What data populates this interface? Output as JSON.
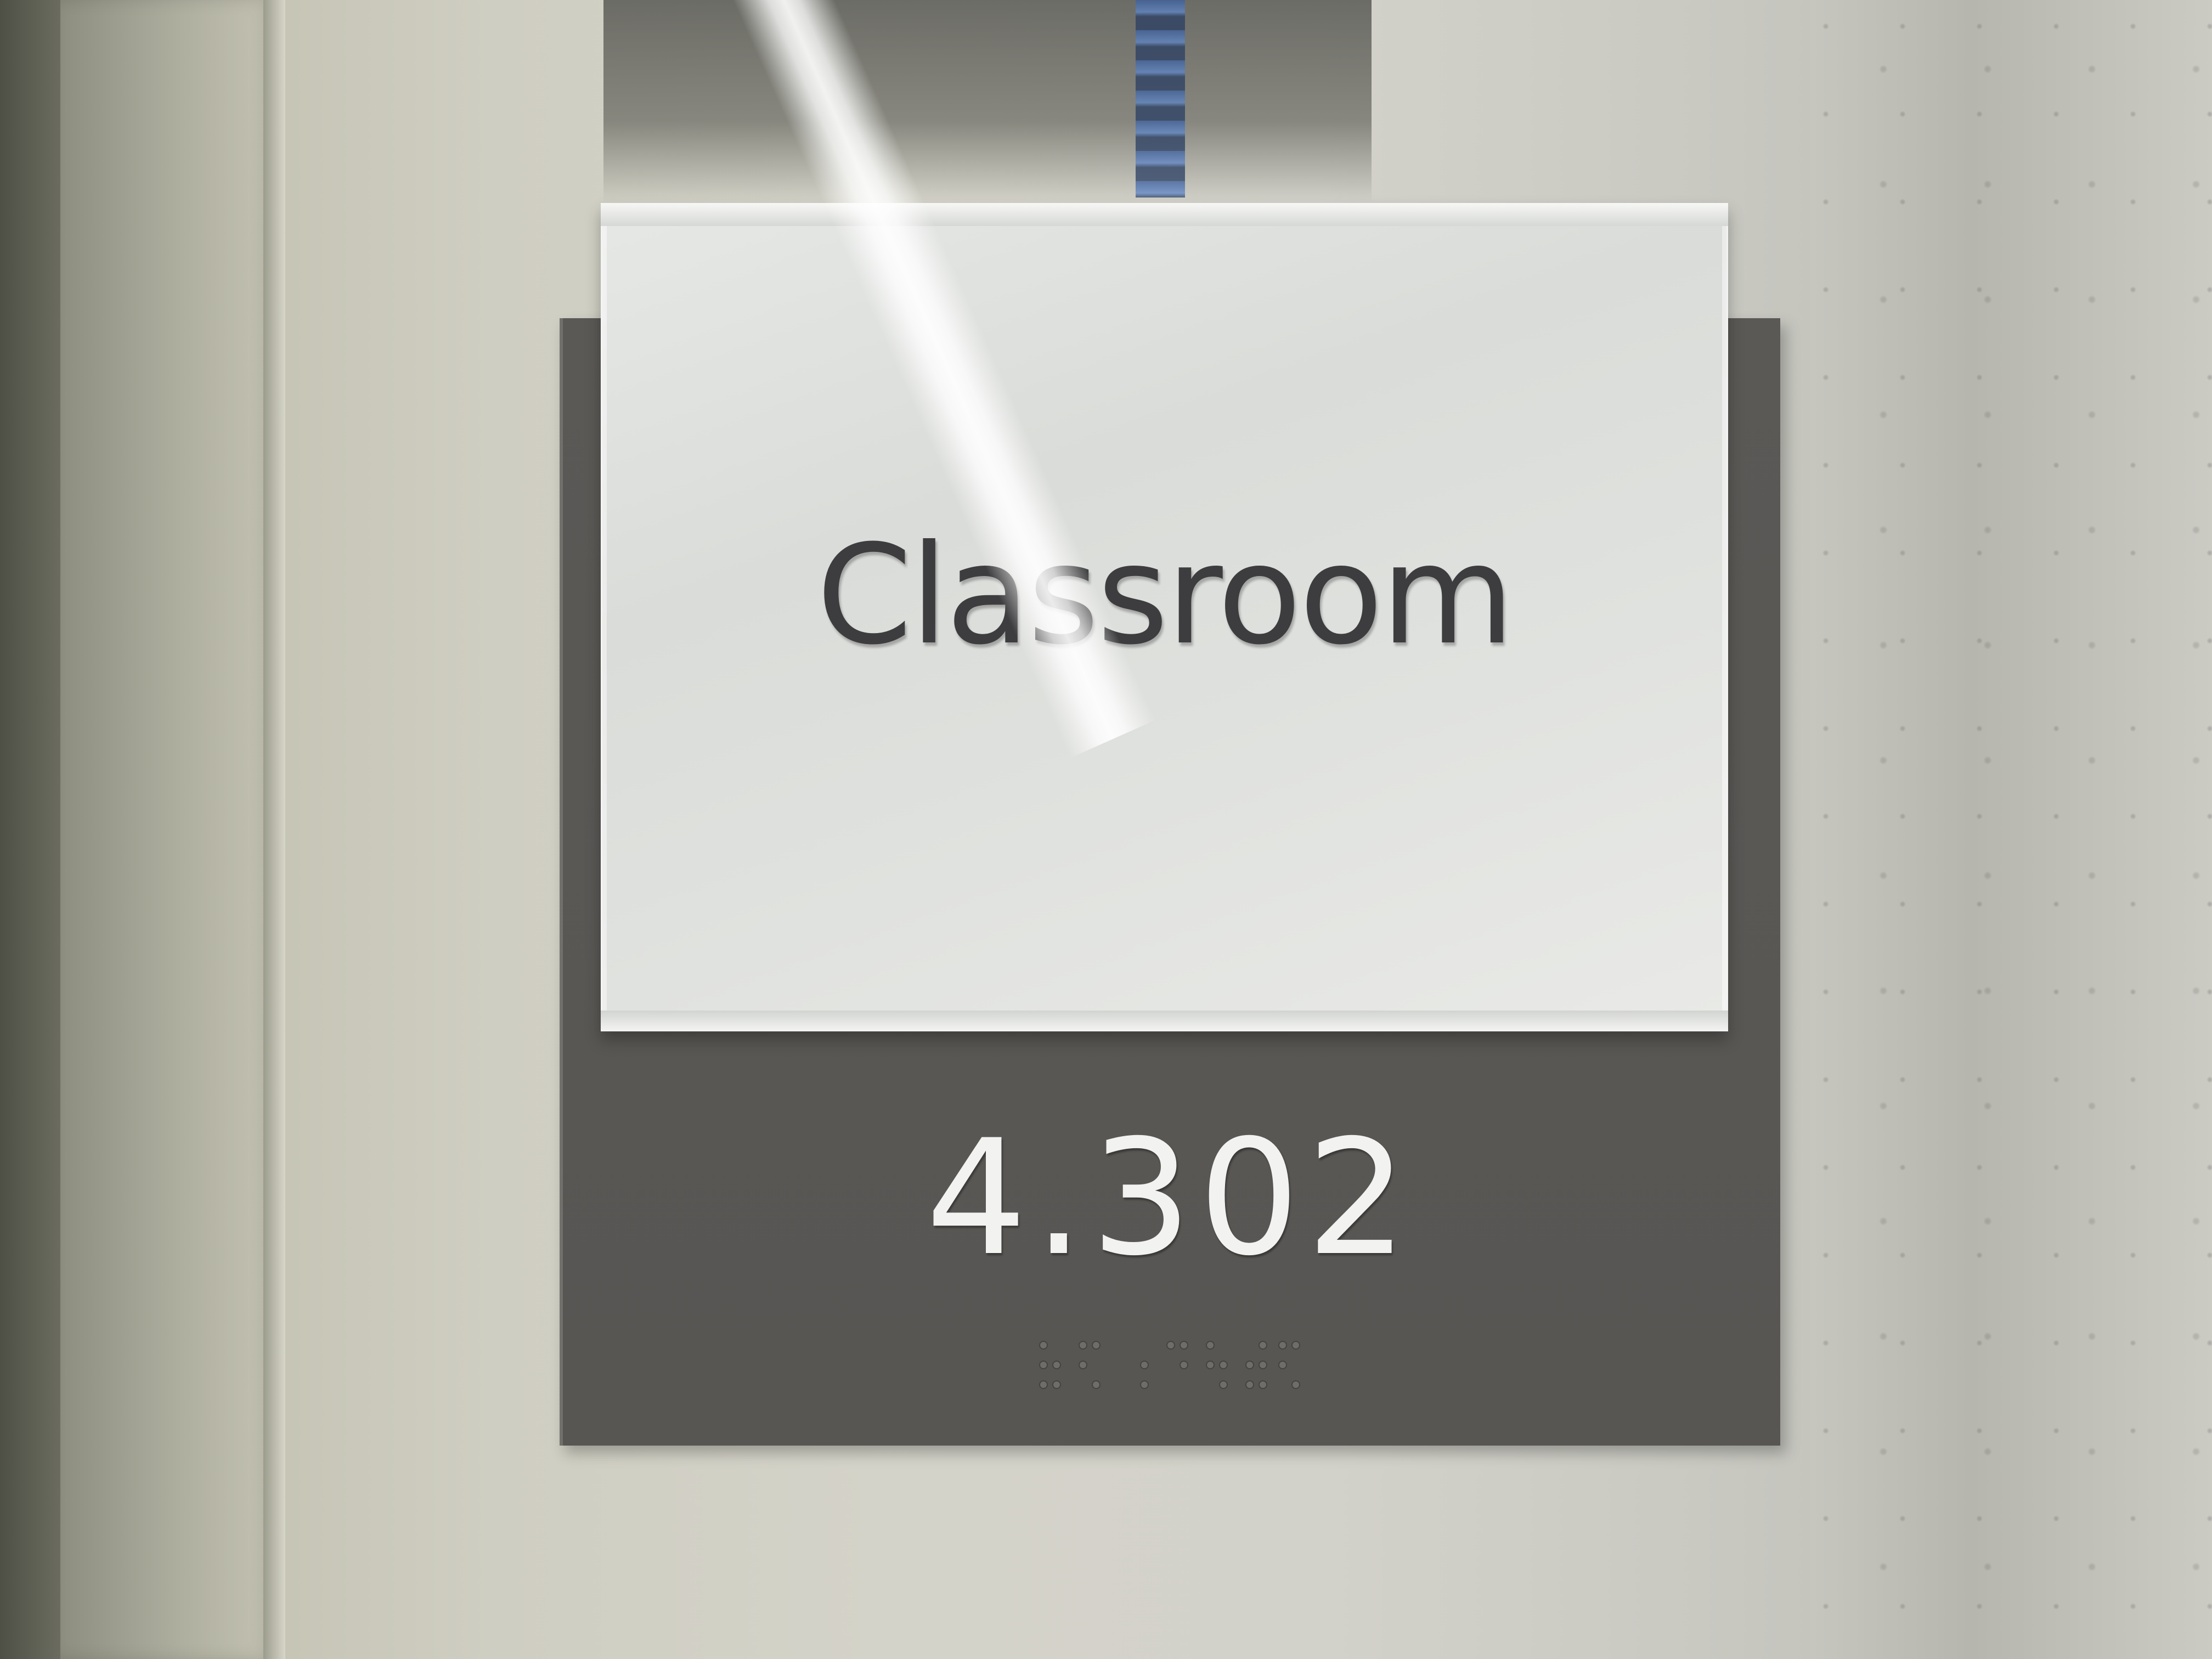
{
  "sign": {
    "room_name": "Classroom",
    "room_number": "4.302",
    "braille_label": "braille room number"
  },
  "colors": {
    "backplate": "#585653",
    "glass_panel": "#dfe1de",
    "room_name_text": "#3d3d3f",
    "room_number_text": "#f2f2f0"
  }
}
